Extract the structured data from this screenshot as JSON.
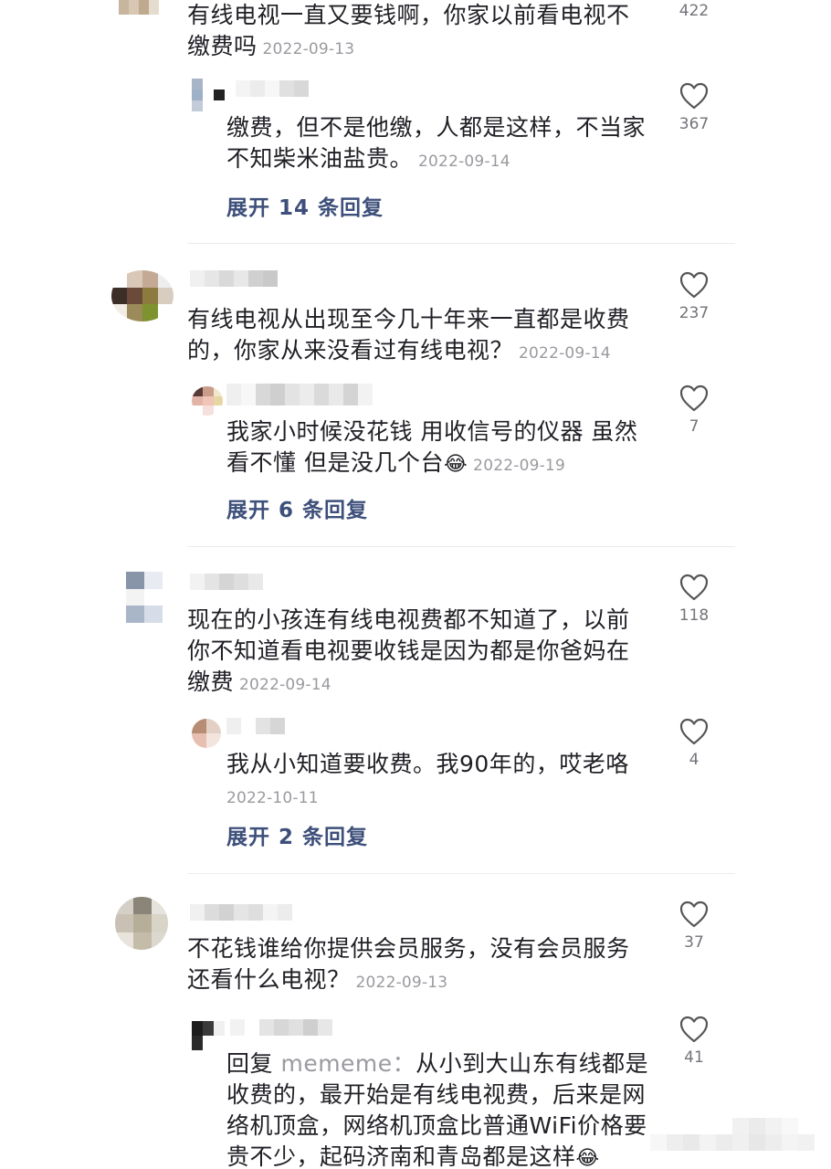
{
  "comments": [
    {
      "text_line1": "有线电视一直又要钱啊，你家以前看电视不",
      "text_line2": "缴费吗",
      "date": "2022-09-13",
      "likes": "422",
      "reply": {
        "text_line1": "缴费，但不是他缴，人都是这样，不当家",
        "text_line2": "不知柴米油盐贵。",
        "date": "2022-09-14",
        "likes": "367"
      },
      "expand_label": "展开 14 条回复"
    },
    {
      "text_line1": "有线电视从出现至今几十年来一直都是收费",
      "text_line2": "的，你家从来没看过有线电视？",
      "date": "2022-09-14",
      "likes": "237",
      "reply": {
        "text_line1": "我家小时候没花钱 用收信号的仪器 虽然",
        "text_line2": "看不懂 但是没几个台",
        "date": "2022-09-19",
        "likes": "7"
      },
      "expand_label": "展开 6 条回复"
    },
    {
      "text_line1": "现在的小孩连有线电视费都不知道了，以前",
      "text_line2": "你不知道看电视要收钱是因为都是你爸妈在",
      "text_line3": "缴费",
      "date": "2022-09-14",
      "likes": "118",
      "reply": {
        "text_line1": "我从小知道要收费。我90年的，哎老咯",
        "date": "2022-10-11",
        "likes": "4"
      },
      "expand_label": "展开 2 条回复"
    },
    {
      "text_line1": "不花钱谁给你提供会员服务，没有会员服务",
      "text_line2": "还看什么电视？",
      "date": "2022-09-13",
      "likes": "37",
      "reply": {
        "reply_prefix": "回复",
        "reply_to": "mememe：",
        "text_line1": "从小到大山东有线都是",
        "text_line2": "收费的，最开始是有线电视费，后来是网",
        "text_line3": "络机顶盒，网络机顶盒比普通WiFi价格要",
        "text_line4": "贵不少，起码济南和青岛都是这样",
        "likes": "41"
      }
    }
  ],
  "icons": {
    "like": "heart-outline-icon",
    "emoji": "crying-face-emoji-icon"
  },
  "colors": {
    "expand_text": "#3d4f7a",
    "date_text": "#9a9aa0",
    "count_text": "#73737a"
  }
}
